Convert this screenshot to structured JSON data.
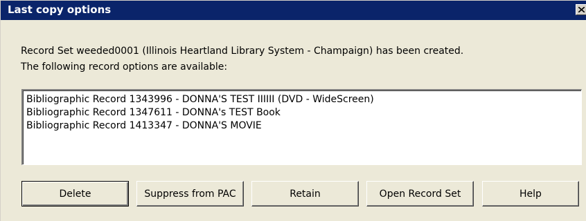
{
  "window": {
    "title": "Last copy options",
    "close_glyph": "×"
  },
  "message": {
    "line1": "Record Set weeded0001 (Illinois Heartland Library System - Champaign) has been created.",
    "line2": "The following record options are available:"
  },
  "records": [
    "Bibliographic Record 1343996 - DONNA'S TEST IIIIII (DVD - WideScreen)",
    "Bibliographic Record 1347611 - DONNA's TEST Book",
    "Bibliographic Record 1413347 - DONNA'S MOVIE"
  ],
  "buttons": {
    "delete": "Delete",
    "suppress": "Suppress from PAC",
    "retain": "Retain",
    "open_record_set": "Open Record Set",
    "help": "Help"
  },
  "colors": {
    "titlebar": "#0a246a",
    "dialog_bg": "#ece9d8"
  }
}
